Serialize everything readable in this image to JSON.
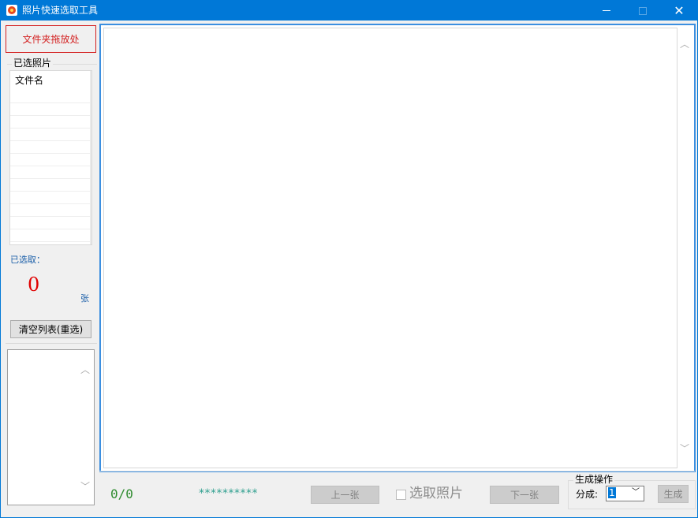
{
  "window": {
    "title": "照片快速选取工具",
    "close_glyph": "✕"
  },
  "left_panel": {
    "drop_zone_label": "文件夹拖放处",
    "selected_group_title": "已选照片",
    "file_list_header": "文件名",
    "selected_label": "已选取：",
    "selected_count": "0",
    "count_unit": "张",
    "clear_button_label": "清空列表(重选)"
  },
  "scroll_glyphs": {
    "up": "︿",
    "down": "﹀"
  },
  "bottom_bar": {
    "progress": "0/0",
    "stars": "**********",
    "prev_button_label": "上一张",
    "select_checkbox_label": "选取照片",
    "select_checked": false,
    "next_button_label": "下一张",
    "generate_group_title": "生成操作",
    "split_label": "分成:",
    "split_value": "1",
    "generate_button_label": "生成"
  },
  "colors": {
    "titlebar": "#0078d7",
    "drop_zone": "#d32020",
    "selected_count": "#e00000",
    "preview_border": "#3c8fe0",
    "progress": "#2e8b2e",
    "stars": "#2f9f8f"
  },
  "icons": {
    "app": "photo-app-icon",
    "minimize": "minimize-icon",
    "maximize": "maximize-icon",
    "close": "close-icon",
    "chevron_down": "chevron-down-icon"
  }
}
